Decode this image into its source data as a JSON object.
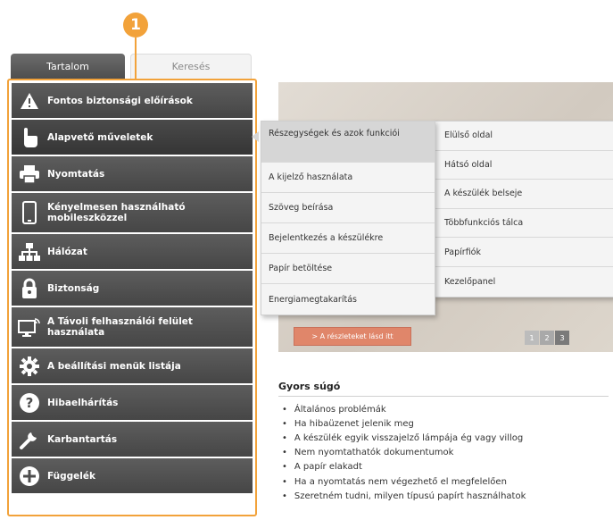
{
  "callout": {
    "number": "1"
  },
  "tabs": {
    "contents": "Tartalom",
    "search": "Keresés"
  },
  "sidebar": {
    "items": [
      {
        "label": "Fontos biztonsági előírások",
        "icon": "warning-icon"
      },
      {
        "label": "Alapvető műveletek",
        "icon": "hand-pointer-icon"
      },
      {
        "label": "Nyomtatás",
        "icon": "printer-icon"
      },
      {
        "label": "Kényelmesen használható\nmobileszközzel",
        "icon": "smartphone-icon"
      },
      {
        "label": "Hálózat",
        "icon": "network-icon"
      },
      {
        "label": "Biztonság",
        "icon": "lock-icon"
      },
      {
        "label": "A Távoli felhasználói felület\nhasználata",
        "icon": "remote-ui-icon"
      },
      {
        "label": "A beállítási menük listája",
        "icon": "gear-icon"
      },
      {
        "label": "Hibaelhárítás",
        "icon": "help-icon"
      },
      {
        "label": "Karbantartás",
        "icon": "wrench-icon"
      },
      {
        "label": "Függelék",
        "icon": "plus-icon"
      }
    ]
  },
  "submenu": {
    "items": [
      "Részegységek és azok funkciói",
      "A kijelző használata",
      "Szöveg beírása",
      "Bejelentkezés a készülékre",
      "Papír betöltése",
      "Energiamegtakarítás"
    ]
  },
  "submenu2": {
    "items": [
      "Elülső oldal",
      "Hátsó oldal",
      "A készülék belseje",
      "Többfunkciós tálca",
      "Papírfiók",
      "Kezelőpanel"
    ]
  },
  "banner": {
    "button": ">  A részleteket lásd itt",
    "pages": [
      "1",
      "2",
      "3"
    ]
  },
  "quick_help": {
    "title": "Gyors súgó",
    "items": [
      "Általános problémák",
      "Ha hibaüzenet jelenik meg",
      "A készülék egyik visszajelző lámpája ég vagy villog",
      "Nem nyomtathatók dokumentumok",
      "A papír elakadt",
      "Ha a nyomtatás nem végezhető el megfelelően",
      "Szeretném tudni, milyen típusú papírt használhatok"
    ]
  }
}
